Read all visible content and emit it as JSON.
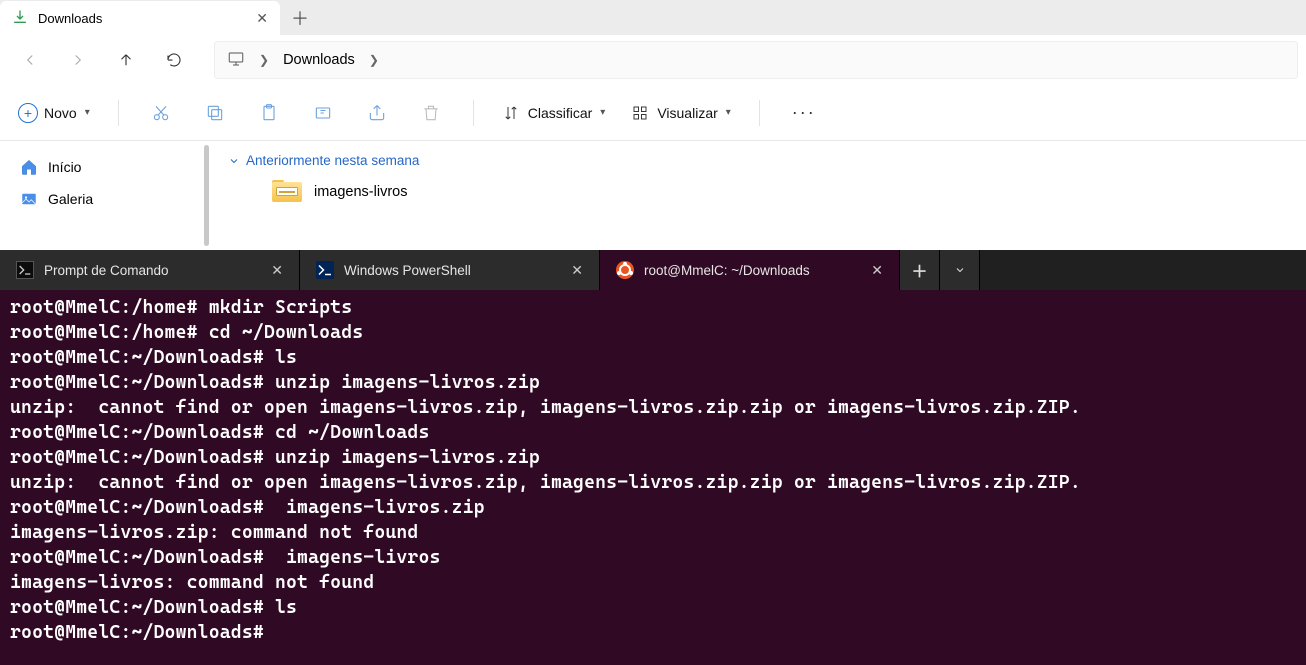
{
  "explorer": {
    "tab": {
      "title": "Downloads"
    },
    "breadcrumb": {
      "segment": "Downloads"
    },
    "new_button": "Novo",
    "sort_label": "Classificar",
    "view_label": "Visualizar",
    "sidebar": {
      "home": "Início",
      "gallery": "Galeria"
    },
    "group_header": "Anteriormente nesta semana",
    "items": [
      {
        "name": "imagens-livros"
      }
    ]
  },
  "terminal": {
    "tabs": [
      {
        "title": "Prompt de Comando",
        "icon": "cmd"
      },
      {
        "title": "Windows PowerShell",
        "icon": "ps"
      },
      {
        "title": "root@MmelC: ~/Downloads",
        "icon": "ubuntu",
        "active": true
      }
    ],
    "lines": [
      "root@MmelC:/home# mkdir Scripts",
      "root@MmelC:/home# cd ~/Downloads",
      "root@MmelC:~/Downloads# ls",
      "root@MmelC:~/Downloads# unzip imagens-livros.zip",
      "unzip:  cannot find or open imagens-livros.zip, imagens-livros.zip.zip or imagens-livros.zip.ZIP.",
      "root@MmelC:~/Downloads# cd ~/Downloads",
      "root@MmelC:~/Downloads# unzip imagens-livros.zip",
      "unzip:  cannot find or open imagens-livros.zip, imagens-livros.zip.zip or imagens-livros.zip.ZIP.",
      "root@MmelC:~/Downloads#  imagens-livros.zip",
      "imagens-livros.zip: command not found",
      "root@MmelC:~/Downloads#  imagens-livros",
      "imagens-livros: command not found",
      "root@MmelC:~/Downloads# ls",
      "root@MmelC:~/Downloads#"
    ]
  }
}
